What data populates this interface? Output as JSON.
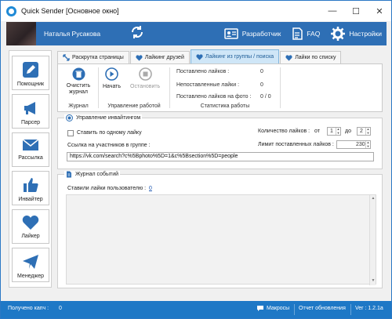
{
  "window": {
    "title": "Quick Sender [Основное окно]",
    "minimize": "—",
    "maximize": "☐",
    "close": "✕"
  },
  "topbar": {
    "user_name": "Наталья Русакова",
    "links": [
      {
        "label": "Разработчик"
      },
      {
        "label": "FAQ"
      },
      {
        "label": "Настройки"
      }
    ]
  },
  "sidebar": {
    "items": [
      {
        "label": "Помощник",
        "icon": "pencil-icon"
      },
      {
        "label": "Парсер",
        "icon": "megaphone-icon"
      },
      {
        "label": "Рассылка",
        "icon": "envelope-icon"
      },
      {
        "label": "Инвайтер",
        "icon": "thumbs-up-icon"
      },
      {
        "label": "Лайкер",
        "icon": "heart-icon"
      },
      {
        "label": "Менеджер",
        "icon": "paper-plane-icon"
      }
    ]
  },
  "tabs": [
    {
      "label": "Раскрутка страницы"
    },
    {
      "label": "Лайкинг друзей"
    },
    {
      "label": "Лайкинг из группы / поиска"
    },
    {
      "label": "Лайки по списку"
    }
  ],
  "ribbon": {
    "journal": {
      "button": "Очистить журнал",
      "caption": "Журнал"
    },
    "control": {
      "start": "Начать",
      "stop": "Остановить",
      "caption": "Управление работой"
    },
    "stats": {
      "caption": "Статистика работы",
      "rows": [
        {
          "label": "Поставлено лайков :",
          "value": "0"
        },
        {
          "label": "Непоставленные лайки :",
          "value": "0"
        },
        {
          "label": "Поставлено лайков на фото :",
          "value": "0 / 0"
        }
      ]
    }
  },
  "inviting": {
    "title": "Управление инвайтингом",
    "one_like_label": "Ставить по одному лайку",
    "likes_count_label": "Количество лайков :",
    "from_label": "от",
    "from_value": "1",
    "to_label": "до",
    "to_value": "2",
    "limit_label": "Лимит поставленных лайков :",
    "limit_value": "230",
    "link_label": "Ссылка на участников в группе :",
    "link_value": "https://vk.com/search?c%5Bphoto%5D=1&c%5Bsection%5D=people"
  },
  "journal": {
    "title": "Журнал событий",
    "status_label": "Ставили лайки пользователю :",
    "status_value": "0"
  },
  "statusbar": {
    "captcha_label": "Получено капч :",
    "captcha_value": "0",
    "macros": "Макросы",
    "report": "Отчет обновления",
    "version": "Ver : 1.2.1a"
  },
  "colors": {
    "accent": "#2e6fb5",
    "statusbar": "#1e78c6",
    "active_tab": "#cfe6f7"
  }
}
